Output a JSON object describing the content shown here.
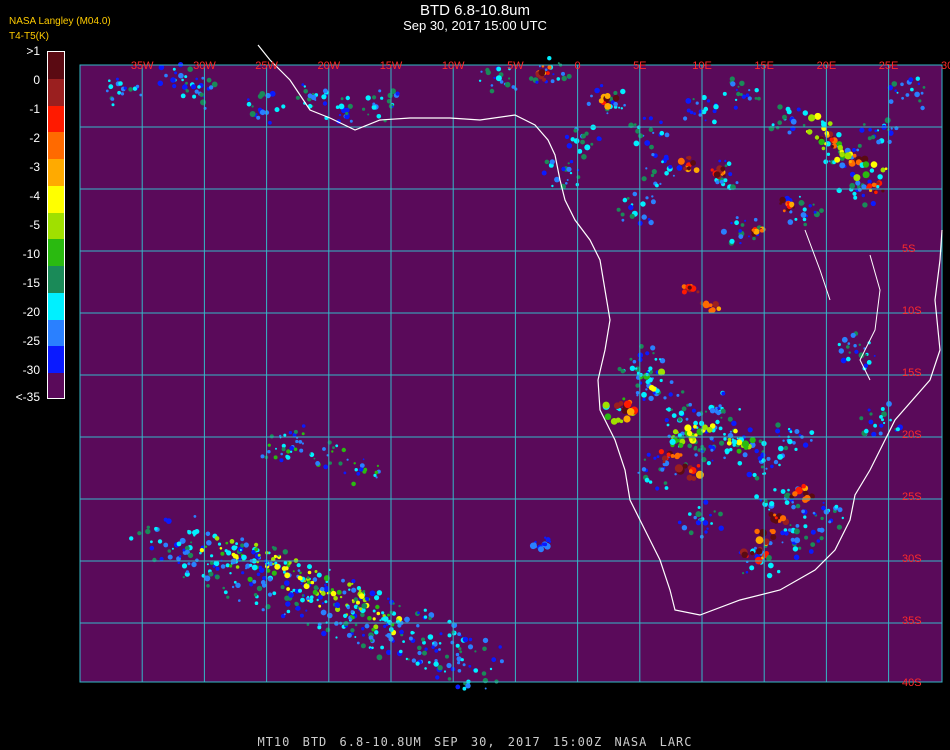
{
  "header": {
    "title": "BTD 6.8-10.8um",
    "subtitle": "Sep 30, 2017 15:00 UTC",
    "logo_line1": "NASA Langley (M04.0)",
    "logo_line2": "T4-T5(K)"
  },
  "colorbar": {
    "colors": [
      "#5a0a12",
      "#9a1f1f",
      "#ff1a00",
      "#ff6a00",
      "#ffaa00",
      "#ffff00",
      "#a0e000",
      "#2aba10",
      "#1a8a58",
      "#00f0ff",
      "#2a80ff",
      "#0a1aff",
      "#5a0a5a"
    ],
    "labels": [
      ">1",
      "0",
      "-1",
      "-2",
      "-3",
      "-4",
      "-5",
      "-10",
      "-15",
      "-20",
      "-25",
      "-30",
      "<-35"
    ]
  },
  "map": {
    "background": "#5a0a5a",
    "grid_color": "#34b8c8",
    "lon_labels": [
      "35W",
      "30W",
      "25W",
      "20W",
      "15W",
      "10W",
      "5W",
      "0",
      "5E",
      "10E",
      "15E",
      "20E",
      "25E",
      "30E",
      "35E"
    ],
    "lat_labels": [
      "5S",
      "10S",
      "15S",
      "20S",
      "25S",
      "30S",
      "35S",
      "40S"
    ],
    "coast_color": "#ffffff",
    "label_color": "#ff2a2a"
  },
  "footer": "MT10  BTD 6.8-10.8UM   SEP 30, 2017 15:00Z   NASA LARC"
}
